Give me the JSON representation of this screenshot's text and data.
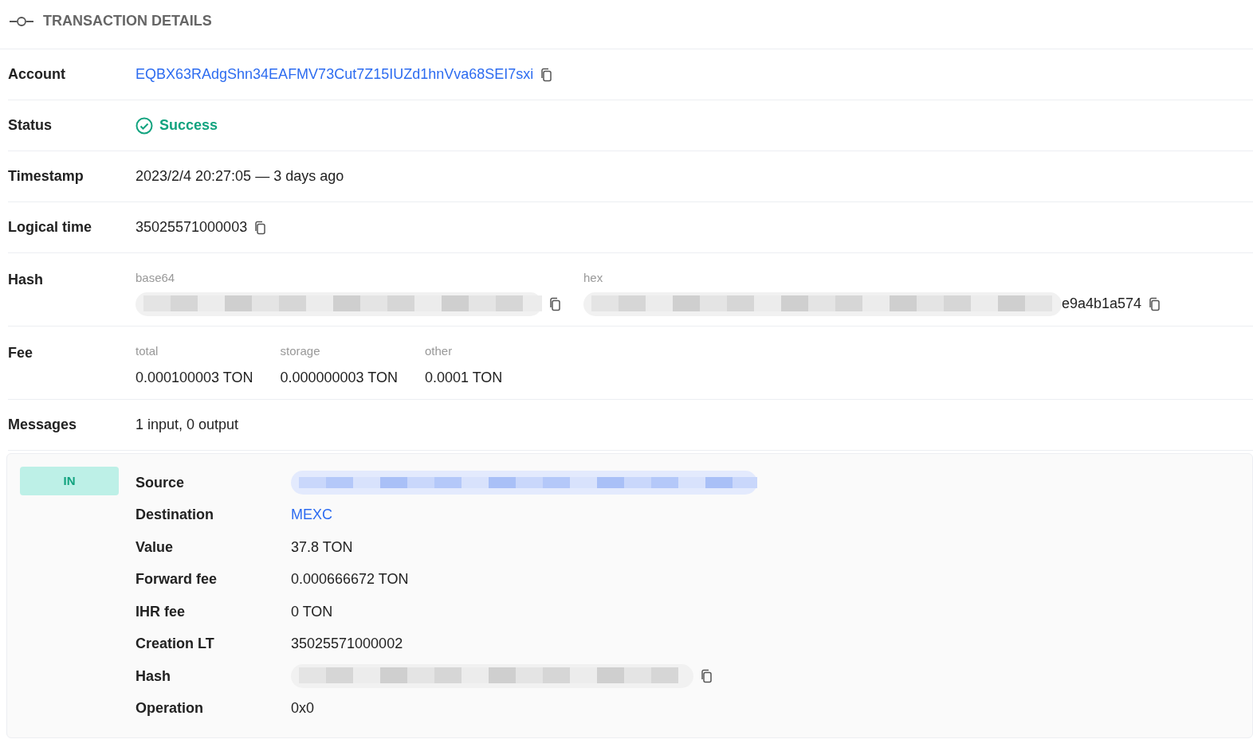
{
  "header": {
    "title": "TRANSACTION DETAILS"
  },
  "rows": [
    {
      "kind": "link",
      "label": "Account",
      "value": "EQBX63RAdgShn34EAFMV73Cut7Z15IUZd1hnVva68SEI7sxi",
      "copyable": true
    },
    {
      "kind": "status",
      "label": "Status",
      "value": "Success",
      "success": true
    },
    {
      "kind": "text",
      "label": "Timestamp",
      "value": "2023/2/4 20:27:05 — 3 days ago",
      "copyable": false
    },
    {
      "kind": "text",
      "label": "Logical time",
      "value": "35025571000003",
      "copyable": true
    },
    {
      "kind": "hash",
      "label": "Hash",
      "base64_label": "base64",
      "hex_label": "hex",
      "hex_tail": "e9a4b1a574"
    },
    {
      "kind": "fee",
      "label": "Fee",
      "parts": [
        {
          "label": "total",
          "value": "0.000100003 TON"
        },
        {
          "label": "storage",
          "value": "0.000000003 TON"
        },
        {
          "label": "other",
          "value": "0.0001 TON"
        }
      ]
    },
    {
      "kind": "text",
      "label": "Messages",
      "value": "1 input, 0 output",
      "copyable": false
    }
  ],
  "message": {
    "direction": "IN",
    "fields": [
      {
        "kind": "redacted_link",
        "label": "Source"
      },
      {
        "kind": "link",
        "label": "Destination",
        "value": "MEXC"
      },
      {
        "kind": "text",
        "label": "Value",
        "value": "37.8 TON"
      },
      {
        "kind": "text",
        "label": "Forward fee",
        "value": "0.000666672 TON"
      },
      {
        "kind": "text",
        "label": "IHR fee",
        "value": "0 TON"
      },
      {
        "kind": "text",
        "label": "Creation LT",
        "value": "35025571000002"
      },
      {
        "kind": "redacted_copy",
        "label": "Hash"
      },
      {
        "kind": "text",
        "label": "Operation",
        "value": "0x0"
      }
    ]
  }
}
